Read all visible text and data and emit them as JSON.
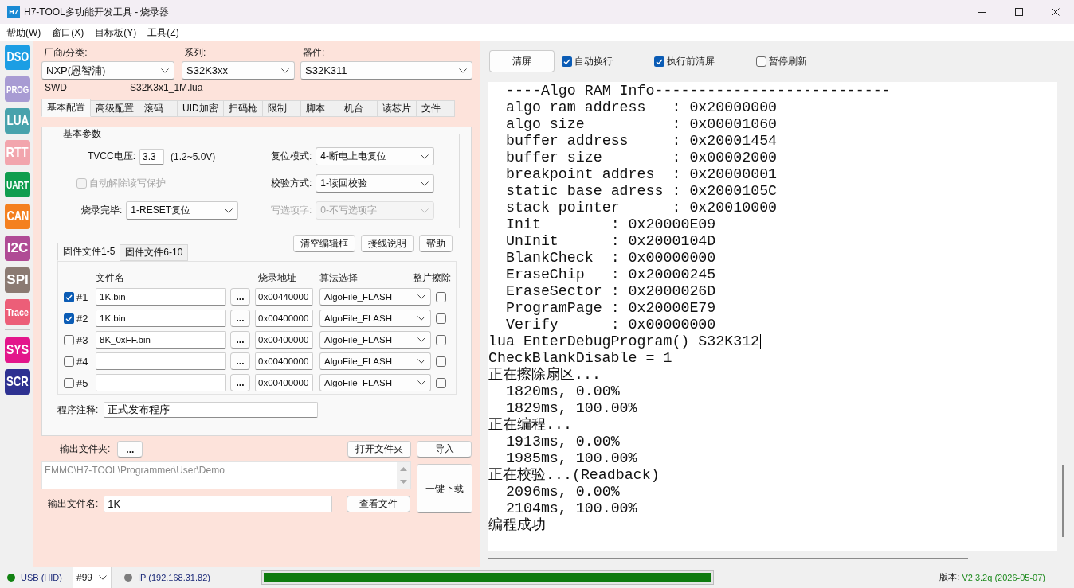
{
  "window": {
    "title": "H7-TOOL多功能开发工具 - 烧录器",
    "logo": "H7"
  },
  "menu": [
    "帮助(W)",
    "窗口(X)",
    "目标板(Y)",
    "工具(Z)"
  ],
  "sidebar": {
    "groups": [
      [
        {
          "label": "DSO",
          "color": "#1b9ee4"
        },
        {
          "label": "PROG",
          "color": "#a89bd3"
        },
        {
          "label": "LUA",
          "color": "#48a2ac"
        },
        {
          "label": "RTT",
          "color": "#f2a5ad"
        },
        {
          "label": "UART",
          "color": "#0f9d4e"
        },
        {
          "label": "CAN",
          "color": "#f4801f"
        },
        {
          "label": "I2C",
          "color": "#b04b95"
        },
        {
          "label": "SPI",
          "color": "#8b7a72"
        },
        {
          "label": "Trace",
          "color": "#ec5e78"
        }
      ],
      [
        {
          "label": "SYS",
          "color": "#e3168b"
        },
        {
          "label": "SCR",
          "color": "#2e3191"
        }
      ]
    ]
  },
  "device": {
    "fields": [
      {
        "label": "厂商/分类:",
        "value": "NXP(恩智浦)"
      },
      {
        "label": "系列:",
        "value": "S32K3xx"
      },
      {
        "label": "器件:",
        "value": "S32K311"
      }
    ],
    "interface": "SWD",
    "script": "S32K3x1_1M.lua"
  },
  "tabs": [
    {
      "label": "基本配置",
      "selected": true
    },
    {
      "label": "高级配置",
      "selected": false
    },
    {
      "label": "滚码",
      "selected": false
    },
    {
      "label": "UID加密",
      "selected": false
    },
    {
      "label": "扫码枪",
      "selected": false
    },
    {
      "label": "限制",
      "selected": false
    },
    {
      "label": "脚本",
      "selected": false
    },
    {
      "label": "机台",
      "selected": false
    },
    {
      "label": "读芯片",
      "selected": false
    },
    {
      "label": "文件",
      "selected": false
    }
  ],
  "basic_params": {
    "title": "基本参数",
    "tvcc": {
      "label": "TVCC电压:",
      "value": "3.3",
      "hint": "(1.2~5.0V)"
    },
    "reset_mode": {
      "label": "复位模式:",
      "value": "4-断电上电复位",
      "disabled": false
    },
    "auto_unprotect": {
      "label": "自动解除读写保护",
      "checked": false,
      "disabled": true
    },
    "verify_mode": {
      "label": "校验方式:",
      "value": "1-读回校验",
      "disabled": false
    },
    "after_program": {
      "label": "烧录完毕:",
      "value": "1-RESET复位",
      "disabled": false
    },
    "option_bytes": {
      "label": "写选项字:",
      "value": "0-不写选项字",
      "disabled": true
    }
  },
  "actions": [
    "清空编辑框",
    "接线说明",
    "帮助"
  ],
  "file_tabs": [
    {
      "label": "固件文件1-5",
      "selected": true
    },
    {
      "label": "固件文件6-10",
      "selected": false
    }
  ],
  "files": {
    "columns": [
      "文件名",
      "烧录地址",
      "算法选择",
      "整片擦除"
    ],
    "rows": [
      {
        "checked": true,
        "number": "#1",
        "file": "1K.bin",
        "browse": "...",
        "address": "0x00440000",
        "algorithm": "AlgoFile_FLASH",
        "erase_chip": false
      },
      {
        "checked": true,
        "number": "#2",
        "file": "1K.bin",
        "browse": "...",
        "address": "0x00400000",
        "algorithm": "AlgoFile_FLASH",
        "erase_chip": false
      },
      {
        "checked": false,
        "number": "#3",
        "file": "8K_0xFF.bin",
        "browse": "...",
        "address": "0x00400000",
        "algorithm": "AlgoFile_FLASH",
        "erase_chip": false
      },
      {
        "checked": false,
        "number": "#4",
        "browse": "...",
        "address": "0x00400000",
        "algorithm": "AlgoFile_FLASH",
        "erase_chip": false
      },
      {
        "checked": false,
        "number": "#5",
        "browse": "...",
        "address": "0x00400000",
        "algorithm": "AlgoFile_FLASH",
        "erase_chip": false
      }
    ]
  },
  "comment": {
    "label": "程序注释:",
    "value": "正式发布程序"
  },
  "output": {
    "folder_label": "输出文件夹:",
    "folder_button": "...",
    "open_folder_button": "打开文件夹",
    "import_button": "导入",
    "path": "EMMC\\H7-TOOL\\Programmer\\User\\Demo",
    "download_button": "一键下载",
    "name_label": "输出文件名:",
    "name": "1K",
    "view_button": "查看文件"
  },
  "console_toolbar": {
    "clear_button": "清屏",
    "options": [
      {
        "label": "自动换行",
        "checked": true
      },
      {
        "label": "执行前清屏",
        "checked": true
      },
      {
        "label": "暂停刷新",
        "checked": false
      }
    ]
  },
  "console": {
    "lines": [
      {
        "text": "----Algo RAM Info---------------------------",
        "indented": true,
        "cursor": false
      },
      {
        "text": "algo ram address   : 0x20000000",
        "indented": true,
        "cursor": false
      },
      {
        "text": "algo size          : 0x00001060",
        "indented": true,
        "cursor": false
      },
      {
        "text": "buffer address     : 0x20001454",
        "indented": true,
        "cursor": false
      },
      {
        "text": "buffer size        : 0x00002000",
        "indented": true,
        "cursor": false
      },
      {
        "text": "breakpoint addres  : 0x20000001",
        "indented": true,
        "cursor": false
      },
      {
        "text": "static base adress : 0x2000105C",
        "indented": true,
        "cursor": false
      },
      {
        "text": "stack pointer      : 0x20010000",
        "indented": true,
        "cursor": false
      },
      {
        "text": "Init        : 0x20000E09",
        "indented": true,
        "cursor": false
      },
      {
        "text": "UnInit      : 0x2000104D",
        "indented": true,
        "cursor": false
      },
      {
        "text": "BlankCheck  : 0x00000000",
        "indented": true,
        "cursor": false
      },
      {
        "text": "EraseChip   : 0x20000245",
        "indented": true,
        "cursor": false
      },
      {
        "text": "EraseSector : 0x2000026D",
        "indented": true,
        "cursor": false
      },
      {
        "text": "ProgramPage : 0x20000E79",
        "indented": true,
        "cursor": false
      },
      {
        "text": "Verify      : 0x00000000",
        "indented": true,
        "cursor": false
      },
      {
        "text": "lua EnterDebugProgram() S32K312",
        "indented": false,
        "cursor": true
      },
      {
        "text": "CheckBlankDisable = 1",
        "indented": false,
        "cursor": false
      },
      {
        "text": "正在擦除扇区...",
        "indented": false,
        "cursor": false
      },
      {
        "text": "1820ms, 0.00%",
        "indented": true,
        "cursor": false
      },
      {
        "text": "1829ms, 100.00%",
        "indented": true,
        "cursor": false
      },
      {
        "text": "正在编程...",
        "indented": false,
        "cursor": false
      },
      {
        "text": "1913ms, 0.00%",
        "indented": true,
        "cursor": false
      },
      {
        "text": "1985ms, 100.00%",
        "indented": true,
        "cursor": false
      },
      {
        "text": "正在校验...(Readback)",
        "indented": false,
        "cursor": false
      },
      {
        "text": "2096ms, 0.00%",
        "indented": true,
        "cursor": false
      },
      {
        "text": "2104ms, 100.00%",
        "indented": true,
        "cursor": false
      },
      {
        "text": "编程成功",
        "indented": false,
        "cursor": false
      }
    ]
  },
  "status_bar": {
    "usb": {
      "label": "USB (HID)",
      "color": "#128212"
    },
    "port": "#99",
    "ip": {
      "label": "IP (192.168.31.82)",
      "color": "#7d7d7d"
    },
    "progress": {
      "level": 1
    },
    "version_label": "版本:",
    "version": "V2.3.2q (2026-05-07)"
  }
}
